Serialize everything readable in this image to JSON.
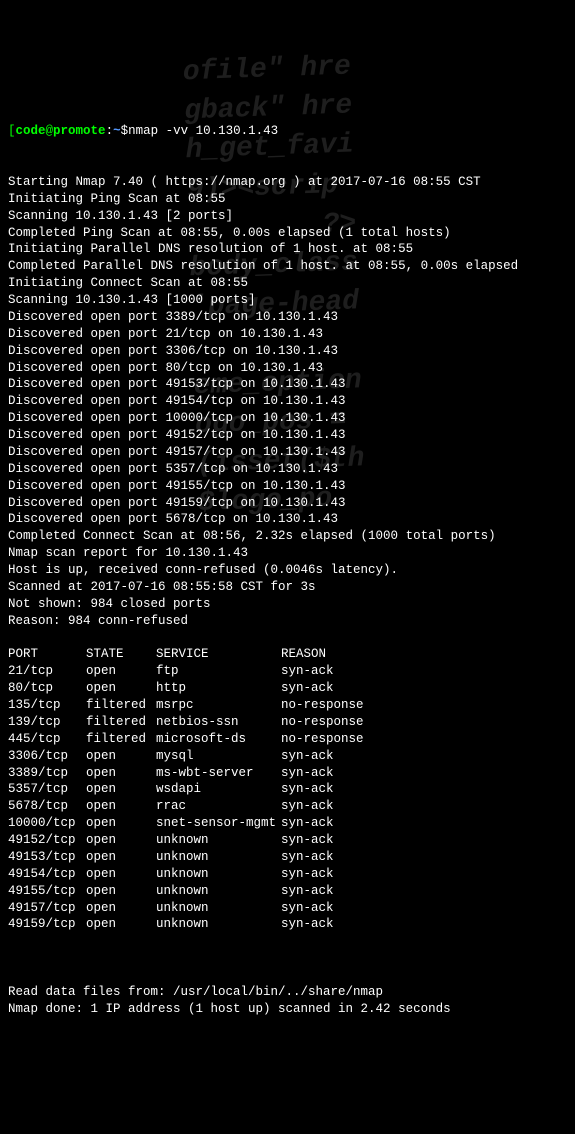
{
  "prompt": {
    "user": "code",
    "host": "promote",
    "path": "~",
    "command": "nmap -vv 10.130.1.43"
  },
  "lines": [
    "Starting Nmap 7.40 ( https://nmap.org ) at 2017-07-16 08:55 CST",
    "Initiating Ping Scan at 08:55",
    "Scanning 10.130.1.43 [2 ports]",
    "Completed Ping Scan at 08:55, 0.00s elapsed (1 total hosts)",
    "Initiating Parallel DNS resolution of 1 host. at 08:55",
    "Completed Parallel DNS resolution of 1 host. at 08:55, 0.00s elapsed",
    "Initiating Connect Scan at 08:55",
    "Scanning 10.130.1.43 [1000 ports]",
    "Discovered open port 3389/tcp on 10.130.1.43",
    "Discovered open port 21/tcp on 10.130.1.43",
    "Discovered open port 3306/tcp on 10.130.1.43",
    "Discovered open port 80/tcp on 10.130.1.43",
    "Discovered open port 49153/tcp on 10.130.1.43",
    "Discovered open port 49154/tcp on 10.130.1.43",
    "Discovered open port 10000/tcp on 10.130.1.43",
    "Discovered open port 49152/tcp on 10.130.1.43",
    "Discovered open port 49157/tcp on 10.130.1.43",
    "Discovered open port 5357/tcp on 10.130.1.43",
    "Discovered open port 49155/tcp on 10.130.1.43",
    "Discovered open port 49159/tcp on 10.130.1.43",
    "Discovered open port 5678/tcp on 10.130.1.43",
    "Completed Connect Scan at 08:56, 2.32s elapsed (1000 total ports)",
    "Nmap scan report for 10.130.1.43",
    "Host is up, received conn-refused (0.0046s latency).",
    "Scanned at 2017-07-16 08:55:58 CST for 3s",
    "Not shown: 984 closed ports",
    "Reason: 984 conn-refused"
  ],
  "table": {
    "headers": {
      "port": "PORT",
      "state": "STATE",
      "service": "SERVICE",
      "reason": "REASON"
    },
    "rows": [
      {
        "port": "21/tcp",
        "state": "open",
        "service": "ftp",
        "reason": "syn-ack"
      },
      {
        "port": "80/tcp",
        "state": "open",
        "service": "http",
        "reason": "syn-ack"
      },
      {
        "port": "135/tcp",
        "state": "filtered",
        "service": "msrpc",
        "reason": "no-response"
      },
      {
        "port": "139/tcp",
        "state": "filtered",
        "service": "netbios-ssn",
        "reason": "no-response"
      },
      {
        "port": "445/tcp",
        "state": "filtered",
        "service": "microsoft-ds",
        "reason": "no-response"
      },
      {
        "port": "3306/tcp",
        "state": "open",
        "service": "mysql",
        "reason": "syn-ack"
      },
      {
        "port": "3389/tcp",
        "state": "open",
        "service": "ms-wbt-server",
        "reason": "syn-ack"
      },
      {
        "port": "5357/tcp",
        "state": "open",
        "service": "wsdapi",
        "reason": "syn-ack"
      },
      {
        "port": "5678/tcp",
        "state": "open",
        "service": "rrac",
        "reason": "syn-ack"
      },
      {
        "port": "10000/tcp",
        "state": "open",
        "service": "snet-sensor-mgmt",
        "reason": "syn-ack"
      },
      {
        "port": "49152/tcp",
        "state": "open",
        "service": "unknown",
        "reason": "syn-ack"
      },
      {
        "port": "49153/tcp",
        "state": "open",
        "service": "unknown",
        "reason": "syn-ack"
      },
      {
        "port": "49154/tcp",
        "state": "open",
        "service": "unknown",
        "reason": "syn-ack"
      },
      {
        "port": "49155/tcp",
        "state": "open",
        "service": "unknown",
        "reason": "syn-ack"
      },
      {
        "port": "49157/tcp",
        "state": "open",
        "service": "unknown",
        "reason": "syn-ack"
      },
      {
        "port": "49159/tcp",
        "state": "open",
        "service": "unknown",
        "reason": "syn-ack"
      }
    ]
  },
  "footer": [
    "Read data files from: /usr/local/bin/../share/nmap",
    "Nmap done: 1 IP address (1 host up) scanned in 2.42 seconds"
  ],
  "bg_text": "ofile\" hre\ngback\" hre\nh_get_favi\n9)><scrip\n        ?>\nbody_class\n'page-head\n\neme_option\nogo_pos =\n(isset($th\n$logo_po"
}
